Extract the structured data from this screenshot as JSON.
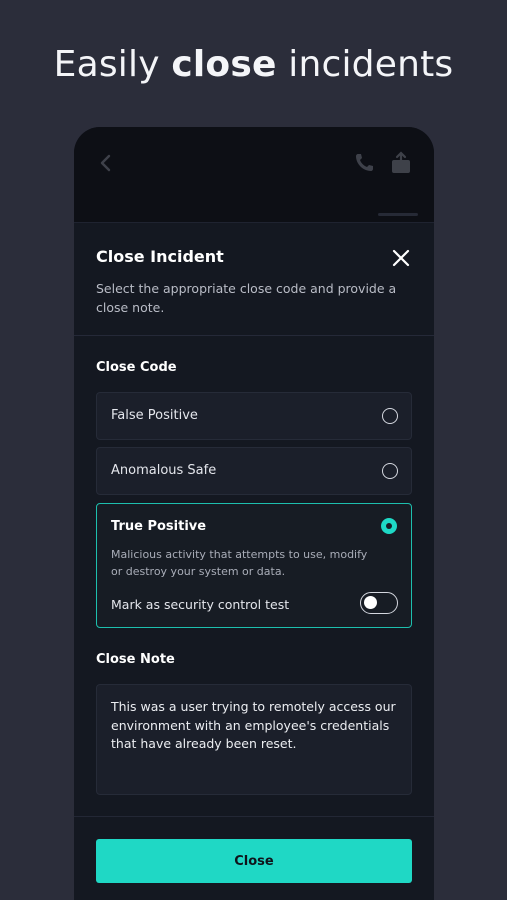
{
  "headline": {
    "prefix": "Easily ",
    "bold": "close",
    "suffix": " incidents"
  },
  "modal": {
    "title": "Close Incident",
    "subtitle": "Select the appropriate close code and provide a close note.",
    "close_code_label": "Close Code",
    "options": [
      {
        "label": "False Positive",
        "selected": false
      },
      {
        "label": "Anomalous Safe",
        "selected": false
      },
      {
        "label": "True Positive",
        "selected": true,
        "description": "Malicious activity that attempts to use, modify or destroy your system or data.",
        "toggle_label": "Mark as security control test",
        "toggle_on": false
      }
    ],
    "close_note_label": "Close Note",
    "close_note_value": "This was a user trying to remotely access our environment with an employee's credentials that have already been reset.",
    "submit_label": "Close"
  },
  "colors": {
    "page_background": "#2b2d3a",
    "sheet_background": "#141821",
    "accent": "#1fd8c5",
    "selected_border": "#1dbfae"
  },
  "icons": [
    "back-arrow-icon",
    "phone-icon",
    "share-icon",
    "close-icon"
  ]
}
